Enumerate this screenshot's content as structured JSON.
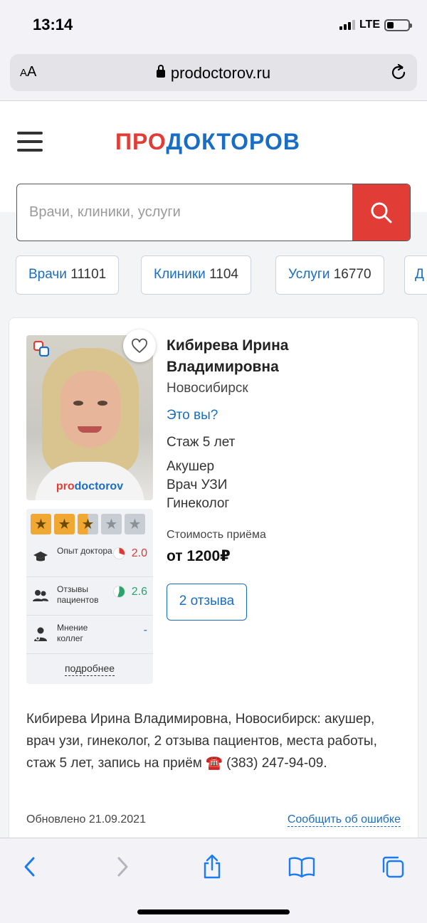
{
  "status": {
    "time": "13:14",
    "network": "LTE"
  },
  "browser": {
    "text_size": "AA",
    "url": "prodoctorov.ru"
  },
  "site": {
    "logo_part1": "ПРО",
    "logo_part2": "ДОКТОРОВ",
    "search_placeholder": "Врачи, клиники, услуги",
    "chips": [
      {
        "label": "Врачи",
        "count": "11101"
      },
      {
        "label": "Клиники",
        "count": "1104"
      },
      {
        "label": "Услуги",
        "count": "16770"
      },
      {
        "label": "Д",
        "count": ""
      }
    ]
  },
  "doctor": {
    "photo_watermark_1": "pro",
    "photo_watermark_2": "doctorov",
    "name": "Кибирева Ирина Владимировна",
    "city": "Новосибирск",
    "is_you_link": "Это вы?",
    "experience": "Стаж 5 лет",
    "specialties": [
      "Акушер",
      "Врач УЗИ",
      "Гинеколог"
    ],
    "price_label": "Стоимость приёма",
    "price": "от 1200₽",
    "reviews_button": "2 отзыва",
    "rating_stars": 2.5,
    "metrics": [
      {
        "label": "Опыт доктора",
        "value": "2.0",
        "color": "#d93a33"
      },
      {
        "label": "Отзывы пациентов",
        "value": "2.6",
        "color": "#2aa46b"
      },
      {
        "label": "Мнение коллег",
        "value": "-",
        "color": "#1a6dc4"
      }
    ],
    "more_link": "подробнее",
    "description": "Кибирева Ирина Владимировна, Новосибирск: акушер, врач узи, гинеколог, 2 отзыва пациентов, места работы, стаж 5 лет, запись на приём ☎️ (383) 247-94-09.",
    "updated": "Обновлено 21.09.2021",
    "report_link": "Сообщить об ошибке"
  },
  "colors": {
    "brand_red": "#e23c36",
    "brand_blue": "#1a6dc4",
    "star": "#f1a832"
  }
}
